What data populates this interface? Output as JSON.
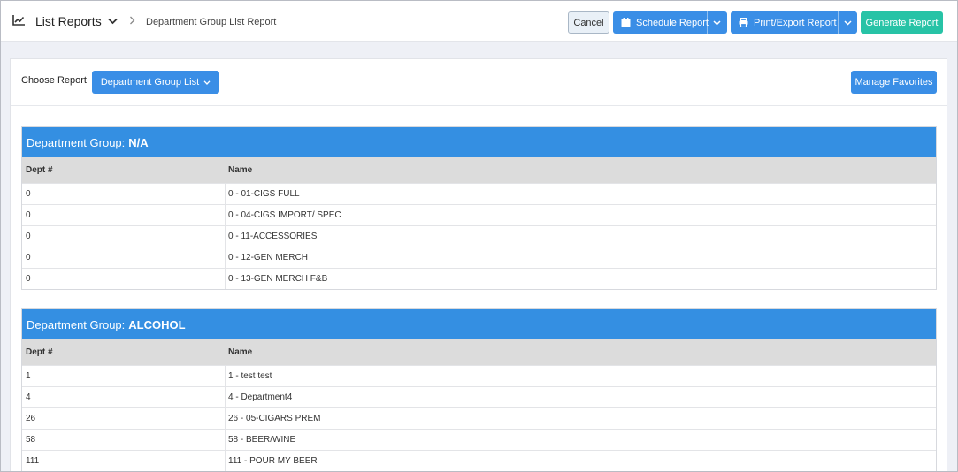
{
  "header": {
    "app_title": "List Reports",
    "breadcrumb": "Department Group List Report",
    "icons": {
      "app": "line-chart-icon",
      "title_caret": "chevron-down-icon",
      "separator": "chevron-right-icon"
    }
  },
  "toolbar": {
    "cancel_label": "Cancel",
    "schedule_label": "Schedule Report",
    "print_label": "Print/Export Report",
    "generate_label": "Generate Report",
    "colors": {
      "primary": "#3a8ee6",
      "generate": "#27c3a6",
      "cancel_bg": "#e9f0f7"
    }
  },
  "chooser": {
    "label": "Choose Report",
    "selected": "Department Group List",
    "manage_favorites": "Manage Favorites"
  },
  "report": {
    "group_prefix": "Department Group:",
    "columns": [
      "Dept #",
      "Name"
    ],
    "groups": [
      {
        "name": "N/A",
        "rows": [
          [
            "0",
            "0 - 01-CIGS FULL"
          ],
          [
            "0",
            "0 - 04-CIGS IMPORT/ SPEC"
          ],
          [
            "0",
            "0 - 11-ACCESSORIES"
          ],
          [
            "0",
            "0 - 12-GEN MERCH"
          ],
          [
            "0",
            "0 - 13-GEN MERCH F&B"
          ]
        ]
      },
      {
        "name": "ALCOHOL",
        "rows": [
          [
            "1",
            "1 - test test"
          ],
          [
            "4",
            "4 - Department4"
          ],
          [
            "26",
            "26 - 05-CIGARS PREM"
          ],
          [
            "58",
            "58 - BEER/WINE"
          ],
          [
            "111",
            "111 - POUR MY BEER"
          ]
        ]
      }
    ],
    "colors": {
      "group_header": "#348fe2",
      "column_header": "#dcdcdc"
    }
  }
}
